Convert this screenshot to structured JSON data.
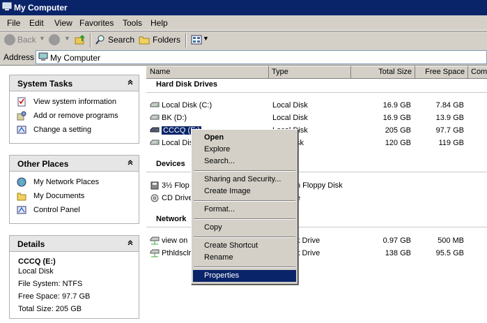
{
  "window": {
    "title": "My Computer"
  },
  "menubar": [
    "File",
    "Edit",
    "View",
    "Favorites",
    "Tools",
    "Help"
  ],
  "toolbar": {
    "back": "Back",
    "search": "Search",
    "folders": "Folders"
  },
  "address": {
    "label": "Address",
    "value": "My Computer"
  },
  "system_tasks": {
    "title": "System Tasks",
    "items": [
      "View system information",
      "Add or remove programs",
      "Change a setting"
    ]
  },
  "other_places": {
    "title": "Other Places",
    "items": [
      "My Network Places",
      "My Documents",
      "Control Panel"
    ]
  },
  "details": {
    "title": "Details",
    "name": "CCCQ (E:)",
    "type": "Local Disk",
    "filesystem": "File System: NTFS",
    "free": "Free Space: 97.7 GB",
    "total": "Total Size: 205 GB"
  },
  "columns": [
    "Name",
    "Type",
    "Total Size",
    "Free Space",
    "Com"
  ],
  "groups": {
    "hard": "Hard Disk Drives",
    "devices": "Devices",
    "network": "Network"
  },
  "hard_drives": [
    {
      "name": "Local Disk (C:)",
      "type": "Local Disk",
      "total": "16.9 GB",
      "free": "7.84 GB"
    },
    {
      "name": "BK (D:)",
      "type": "Local Disk",
      "total": "16.9 GB",
      "free": "13.9 GB"
    },
    {
      "name": "CCCQ (E:)",
      "type": "Local Disk",
      "total": "205 GB",
      "free": "97.7 GB"
    },
    {
      "name": "Local Disk",
      "type": "sk",
      "total": "120 GB",
      "free": "119 GB"
    }
  ],
  "devices": [
    {
      "name": "3½ Flop",
      "type": "h Floppy Disk"
    },
    {
      "name": "CD Drive",
      "type": "e"
    }
  ],
  "network_drives": [
    {
      "name": "view on",
      "type": "k Drive",
      "total": "0.97 GB",
      "free": "500 MB"
    },
    {
      "name": "Pthldsclr",
      "type": "k Drive",
      "total": "138 GB",
      "free": "95.5 GB"
    }
  ],
  "context_menu": {
    "open": "Open",
    "explore": "Explore",
    "search": "Search...",
    "sharing": "Sharing and Security...",
    "create_image": "Create Image",
    "format": "Format...",
    "copy": "Copy",
    "create_shortcut": "Create Shortcut",
    "rename": "Rename",
    "properties": "Properties"
  },
  "colors": {
    "titlebar": "#0a246a",
    "selection": "#0a246a",
    "chrome": "#d4d0c8"
  }
}
